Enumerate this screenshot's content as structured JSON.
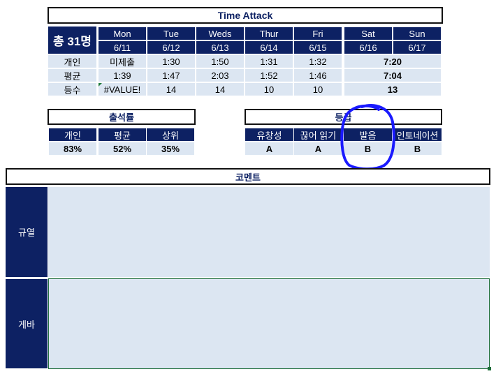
{
  "time_attack": {
    "title": "Time Attack",
    "total": "총 31명",
    "days": [
      "Mon",
      "Tue",
      "Weds",
      "Thur",
      "Fri",
      "Sat",
      "Sun"
    ],
    "dates": [
      "6/11",
      "6/12",
      "6/13",
      "6/14",
      "6/15",
      "6/16",
      "6/17"
    ],
    "rows": [
      {
        "label": "개인",
        "values": [
          "미제출",
          "1:30",
          "1:50",
          "1:31",
          "1:32"
        ],
        "weekend": "7:20"
      },
      {
        "label": "평균",
        "values": [
          "1:39",
          "1:47",
          "2:03",
          "1:52",
          "1:46"
        ],
        "weekend": "7:04"
      },
      {
        "label": "등수",
        "values": [
          "#VALUE!",
          "14",
          "14",
          "10",
          "10"
        ],
        "weekend": "13"
      }
    ]
  },
  "attendance": {
    "title": "출석률",
    "headers": [
      "개인",
      "평균",
      "상위"
    ],
    "values": [
      "83%",
      "52%",
      "35%"
    ]
  },
  "grade": {
    "title": "등급",
    "headers": [
      "유창성",
      "끊어 읽기",
      "발음",
      "인토네이션"
    ],
    "values": [
      "A",
      "A",
      "B",
      "B"
    ]
  },
  "comment": {
    "title": "코멘트",
    "rows": [
      {
        "label": "규열",
        "text": ""
      },
      {
        "label": "게바",
        "text": ""
      }
    ]
  },
  "annotation": {
    "color": "#1a1aff",
    "target": "발음"
  }
}
